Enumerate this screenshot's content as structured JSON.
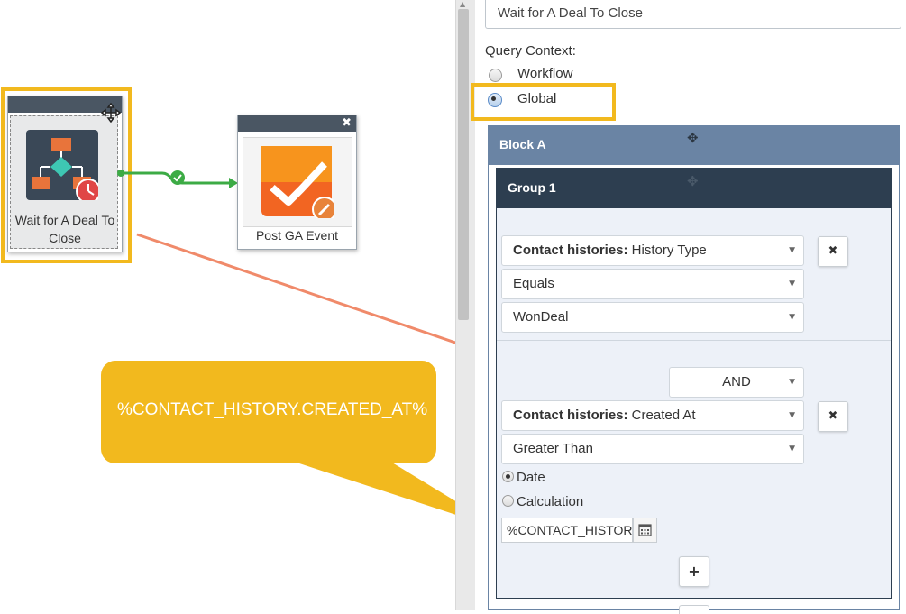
{
  "canvas": {
    "wait_node": {
      "label_line1": "Wait for A Deal To",
      "label_line2": "Close",
      "close_icon": "close-icon"
    },
    "ga_node": {
      "label": "Post GA Event",
      "close_icon": "close-icon"
    },
    "connector": {
      "status_icon": "check-circle-icon",
      "color": "#3cab45"
    },
    "callout": {
      "text": "%CONTACT_HISTORY.CREATED_AT%",
      "color": "#f2b91e"
    },
    "highlight_color": "#f2b91e",
    "arrow_color": "#f08a6a"
  },
  "panel": {
    "name_value": "Wait for A Deal To Close",
    "query_context_label": "Query Context:",
    "context_options": [
      {
        "label": "Workflow",
        "selected": false
      },
      {
        "label": "Global",
        "selected": true
      }
    ],
    "block_title": "Block A",
    "group_title": "Group 1",
    "condition1": {
      "field_bold": "Contact histories:",
      "field_rest": " History Type",
      "operator": "Equals",
      "value": "WonDeal"
    },
    "condition2": {
      "conjunction": "AND",
      "field_bold": "Contact histories:",
      "field_rest": " Created At",
      "operator": "Greater Than",
      "value_types": [
        {
          "label": "Date",
          "selected": true
        },
        {
          "label": "Calculation",
          "selected": false
        }
      ],
      "date_value": "%CONTACT_HISTORY"
    },
    "remove_label": "✖",
    "add_label": "+",
    "colors": {
      "block_header": "#6a84a4",
      "group_header": "#2d3e50",
      "group_body": "#edf1f8"
    }
  }
}
